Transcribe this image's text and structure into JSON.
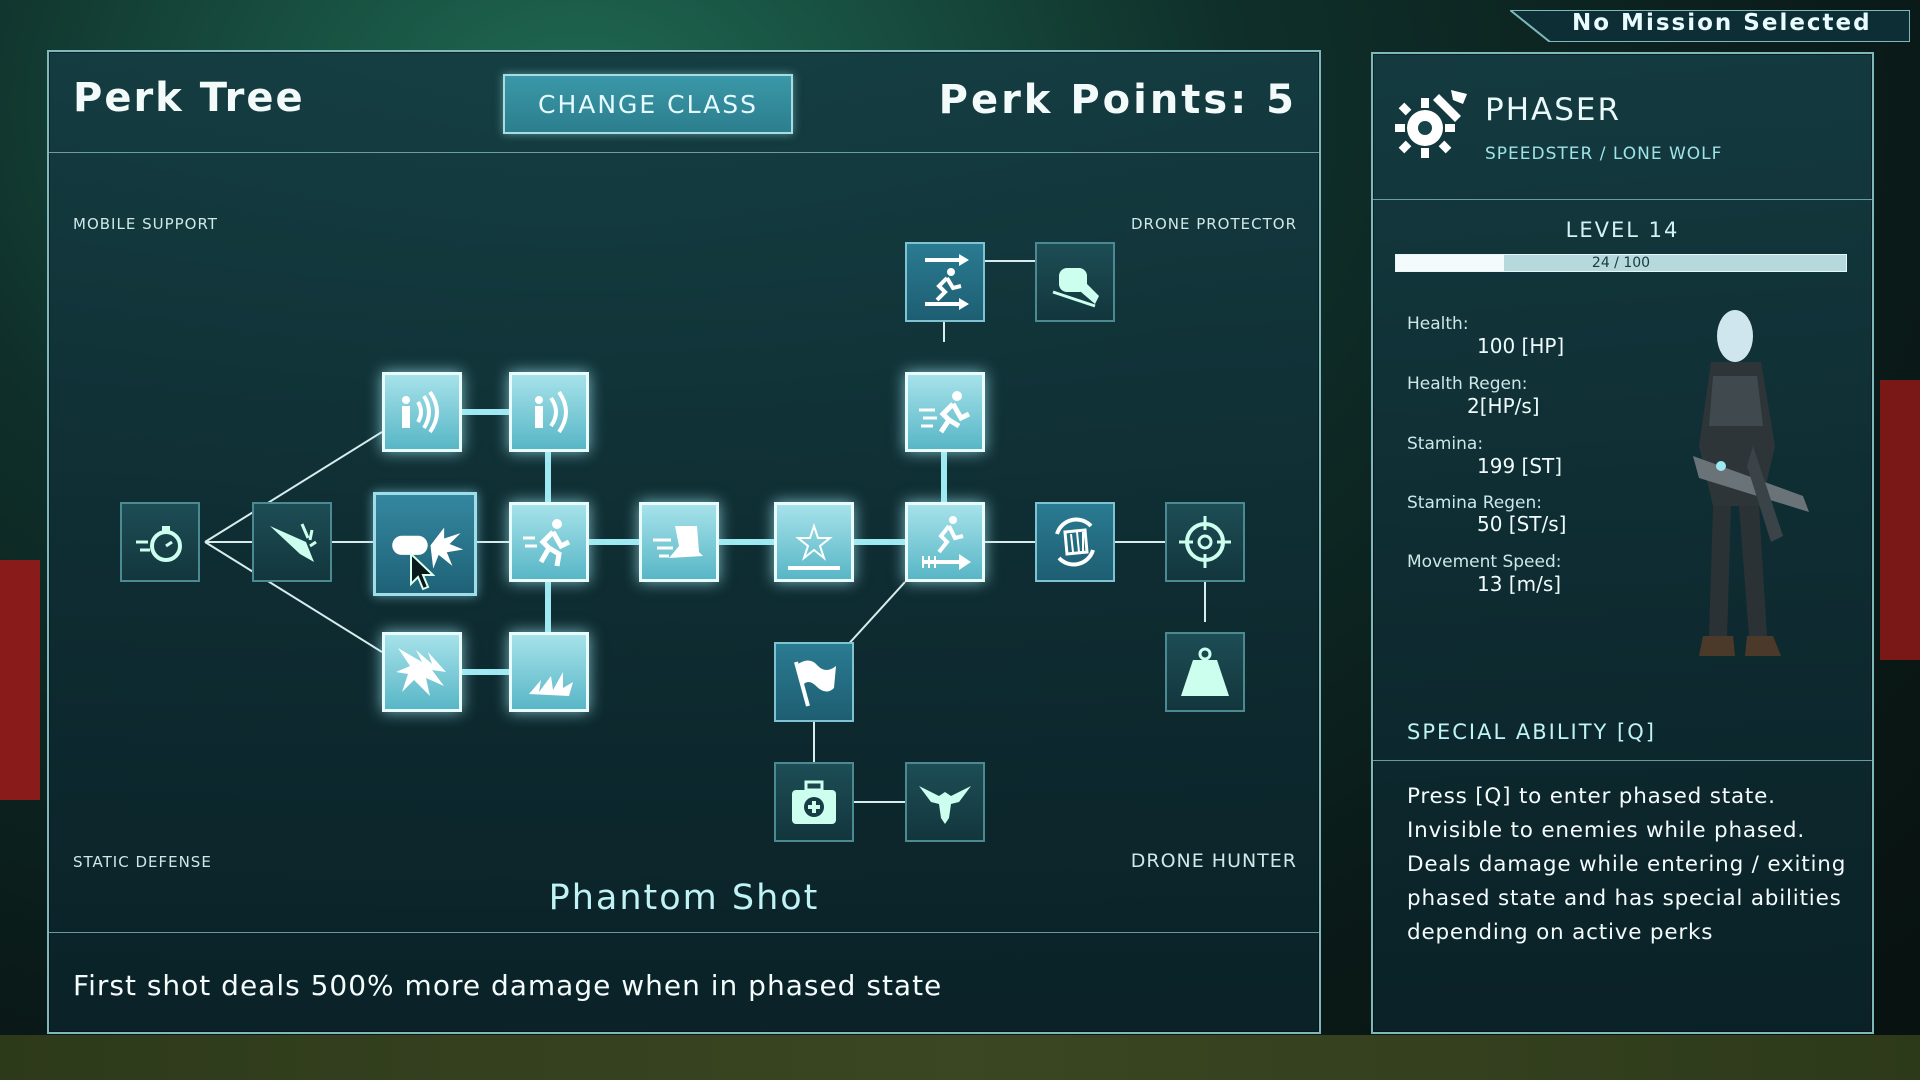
{
  "mission": {
    "status": "No Mission Selected"
  },
  "perk_tree": {
    "title": "Perk Tree",
    "change_class_label": "CHANGE CLASS",
    "perk_points_label": "Perk Points: 5",
    "corners": {
      "top_left": "MOBILE SUPPORT",
      "top_right": "DRONE PROTECTOR",
      "bottom_left": "STATIC DEFENSE",
      "bottom_right": "DRONE HUNTER"
    },
    "selected_perk": {
      "name": "Phantom Shot",
      "description": "First shot deals 500% more damage when in phased state"
    },
    "perks": [
      {
        "icon": "stopwatch-dash-icon",
        "state": "locked"
      },
      {
        "icon": "impact-slash-icon",
        "state": "locked"
      },
      {
        "icon": "phantom-shot-icon",
        "state": "selected"
      },
      {
        "icon": "sound-wave-person-icon",
        "state": "active"
      },
      {
        "icon": "sound-wave-person-small-icon",
        "state": "active"
      },
      {
        "icon": "burst-shards-icon",
        "state": "active"
      },
      {
        "icon": "burst-shards-small-icon",
        "state": "active"
      },
      {
        "icon": "sprint-blur-icon",
        "state": "active"
      },
      {
        "icon": "speed-boot-icon",
        "state": "active"
      },
      {
        "icon": "star-bar-icon",
        "state": "active"
      },
      {
        "icon": "run-arrows-icon",
        "state": "active"
      },
      {
        "icon": "sprint-dash-icon",
        "state": "active"
      },
      {
        "icon": "run-double-arrow-icon",
        "state": "available"
      },
      {
        "icon": "punch-fist-icon",
        "state": "locked"
      },
      {
        "icon": "rotate-shield-icon",
        "state": "available"
      },
      {
        "icon": "crosshair-icon",
        "state": "locked"
      },
      {
        "icon": "weight-icon",
        "state": "locked"
      },
      {
        "icon": "flag-icon",
        "state": "available"
      },
      {
        "icon": "medkit-icon",
        "state": "locked"
      },
      {
        "icon": "eagle-icon",
        "state": "locked"
      }
    ]
  },
  "class_panel": {
    "icon": "gear-wrench-icon",
    "name": "PHASER",
    "subtitle": "SPEEDSTER / LONE WOLF",
    "level": "LEVEL 14",
    "xp_text": "24 / 100",
    "xp_fraction": 0.24,
    "stats": [
      {
        "label": "Health:",
        "value": "100 [HP]"
      },
      {
        "label": "Health Regen:",
        "value": "2[HP/s]"
      },
      {
        "label": "Stamina:",
        "value": "199 [ST]"
      },
      {
        "label": "Stamina Regen:",
        "value": "50 [ST/s]"
      },
      {
        "label": "Movement Speed:",
        "value": "13 [m/s]"
      }
    ],
    "special_ability_title": "SPECIAL ABILITY [Q]",
    "special_ability_desc": "Press [Q] to enter phased state. Invisible to enemies while phased. Deals damage while entering / exiting phased state and has special abilities depending on active perks"
  },
  "colors": {
    "accent": "#9fe9f2",
    "panel_border": "#7fb8bb",
    "active_perk": "#a6e2ea",
    "locked_perk": "#1d4d55"
  }
}
